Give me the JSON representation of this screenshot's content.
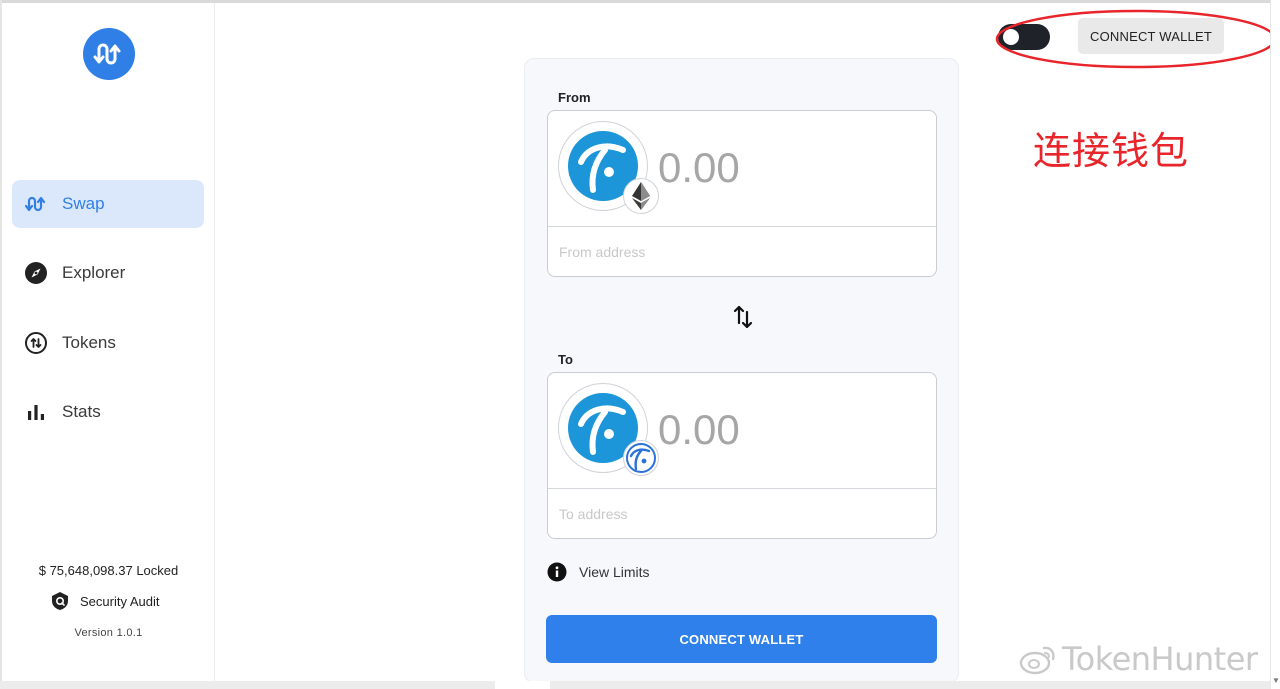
{
  "sidebar": {
    "items": [
      {
        "label": "Swap",
        "icon": "swap-icon",
        "active": true
      },
      {
        "label": "Explorer",
        "icon": "compass-icon",
        "active": false
      },
      {
        "label": "Tokens",
        "icon": "tokens-icon",
        "active": false
      },
      {
        "label": "Stats",
        "icon": "bar-chart-icon",
        "active": false
      }
    ],
    "locked_text": "$ 75,648,098.37 Locked",
    "audit_label": "Security Audit",
    "version": "Version 1.0.1"
  },
  "header": {
    "connect_label": "CONNECT WALLET",
    "theme_toggle_icon": "dark-mode-toggle"
  },
  "annotation": {
    "text": "连接钱包",
    "color": "#e8252a"
  },
  "swap": {
    "from": {
      "label": "From",
      "amount_placeholder": "0.00",
      "address_placeholder": "From address",
      "chain_icon": "ethereum-icon"
    },
    "to": {
      "label": "To",
      "amount_placeholder": "0.00",
      "address_placeholder": "To address",
      "chain_icon": "fantom-chain-icon"
    },
    "swap_direction_icon": "swap-arrows-icon",
    "view_limits_label": "View Limits",
    "connect_label": "CONNECT WALLET"
  },
  "watermark": {
    "text": "TokenHunter"
  },
  "colors": {
    "accent": "#2f80ea",
    "active_nav_bg": "#dbe8fb",
    "token_blue": "#1c96d8"
  }
}
